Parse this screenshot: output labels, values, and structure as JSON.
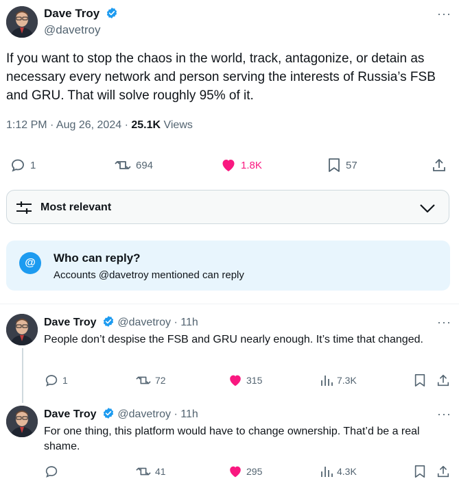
{
  "tweet": {
    "author_name": "Dave Troy",
    "author_handle": "@davetroy",
    "text": "If you want to stop the chaos in the world, track, antagonize, or detain as necessary every network and person serving the interests of Russia’s FSB and GRU. That will solve roughly 95% of it.",
    "time": "1:12 PM · Aug 26, 2024 · ",
    "views_count": "25.1K",
    "views_label": " Views",
    "replies": "1",
    "reposts": "694",
    "likes": "1.8K",
    "bookmarks": "57",
    "more": "···"
  },
  "sort": {
    "label": "Most relevant"
  },
  "who_can_reply": {
    "icon": "@",
    "title": "Who can reply?",
    "subtitle": "Accounts @davetroy mentioned can reply"
  },
  "replies": [
    {
      "author_name": "Dave Troy",
      "author_handle": "@davetroy",
      "time": "· 11h",
      "text": "People don’t despise the FSB and GRU nearly enough. It’s time that changed.",
      "replies": "1",
      "reposts": "72",
      "likes": "315",
      "views": "7.3K",
      "more": "···"
    },
    {
      "author_name": "Dave Troy",
      "author_handle": "@davetroy",
      "time": "· 11h",
      "text": "For one thing, this platform would have to change ownership. That’d be a real shame.",
      "replies": "",
      "reposts": "41",
      "likes": "295",
      "views": "4.3K",
      "more": "···"
    }
  ],
  "colors": {
    "accent": "#1d9bf0",
    "like": "#f91880",
    "muted": "#536471",
    "reply_box_bg": "#e8f5fd"
  }
}
